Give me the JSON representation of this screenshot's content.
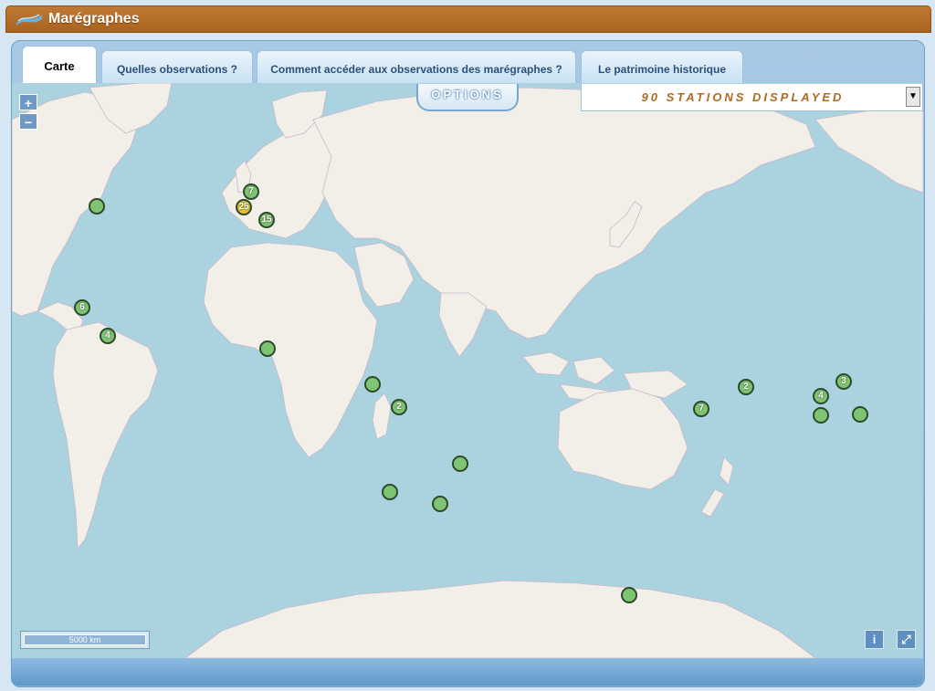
{
  "app": {
    "title": "Marégraphes"
  },
  "tabs": [
    {
      "label": "Carte"
    },
    {
      "label": "Quelles observations ?"
    },
    {
      "label": "Comment accéder aux observations des marégraphes ?"
    },
    {
      "label": "Le patrimoine historique"
    }
  ],
  "map": {
    "zoom_in": "+",
    "zoom_out": "−",
    "options_label": "OPTIONS",
    "stations_selected": "90 STATIONS DISPLAYED",
    "scale_label": "5000 km",
    "info_label": "i",
    "fullscreen_label": "⤢",
    "markers": [
      {
        "label": "7"
      },
      {
        "label": "25"
      },
      {
        "label": "15"
      },
      {
        "label": ""
      },
      {
        "label": "6"
      },
      {
        "label": "4"
      },
      {
        "label": ""
      },
      {
        "label": ""
      },
      {
        "label": "2"
      },
      {
        "label": ""
      },
      {
        "label": ""
      },
      {
        "label": ""
      },
      {
        "label": "7"
      },
      {
        "label": "2"
      },
      {
        "label": "3"
      },
      {
        "label": "4"
      },
      {
        "label": ""
      },
      {
        "label": ""
      },
      {
        "label": ""
      }
    ],
    "colors": {
      "water": "#aad3df",
      "land": "#f2efe9",
      "marker": "#7fc472",
      "marker_border": "#2e4a2a",
      "cluster_warn": "#e6c02e"
    }
  }
}
